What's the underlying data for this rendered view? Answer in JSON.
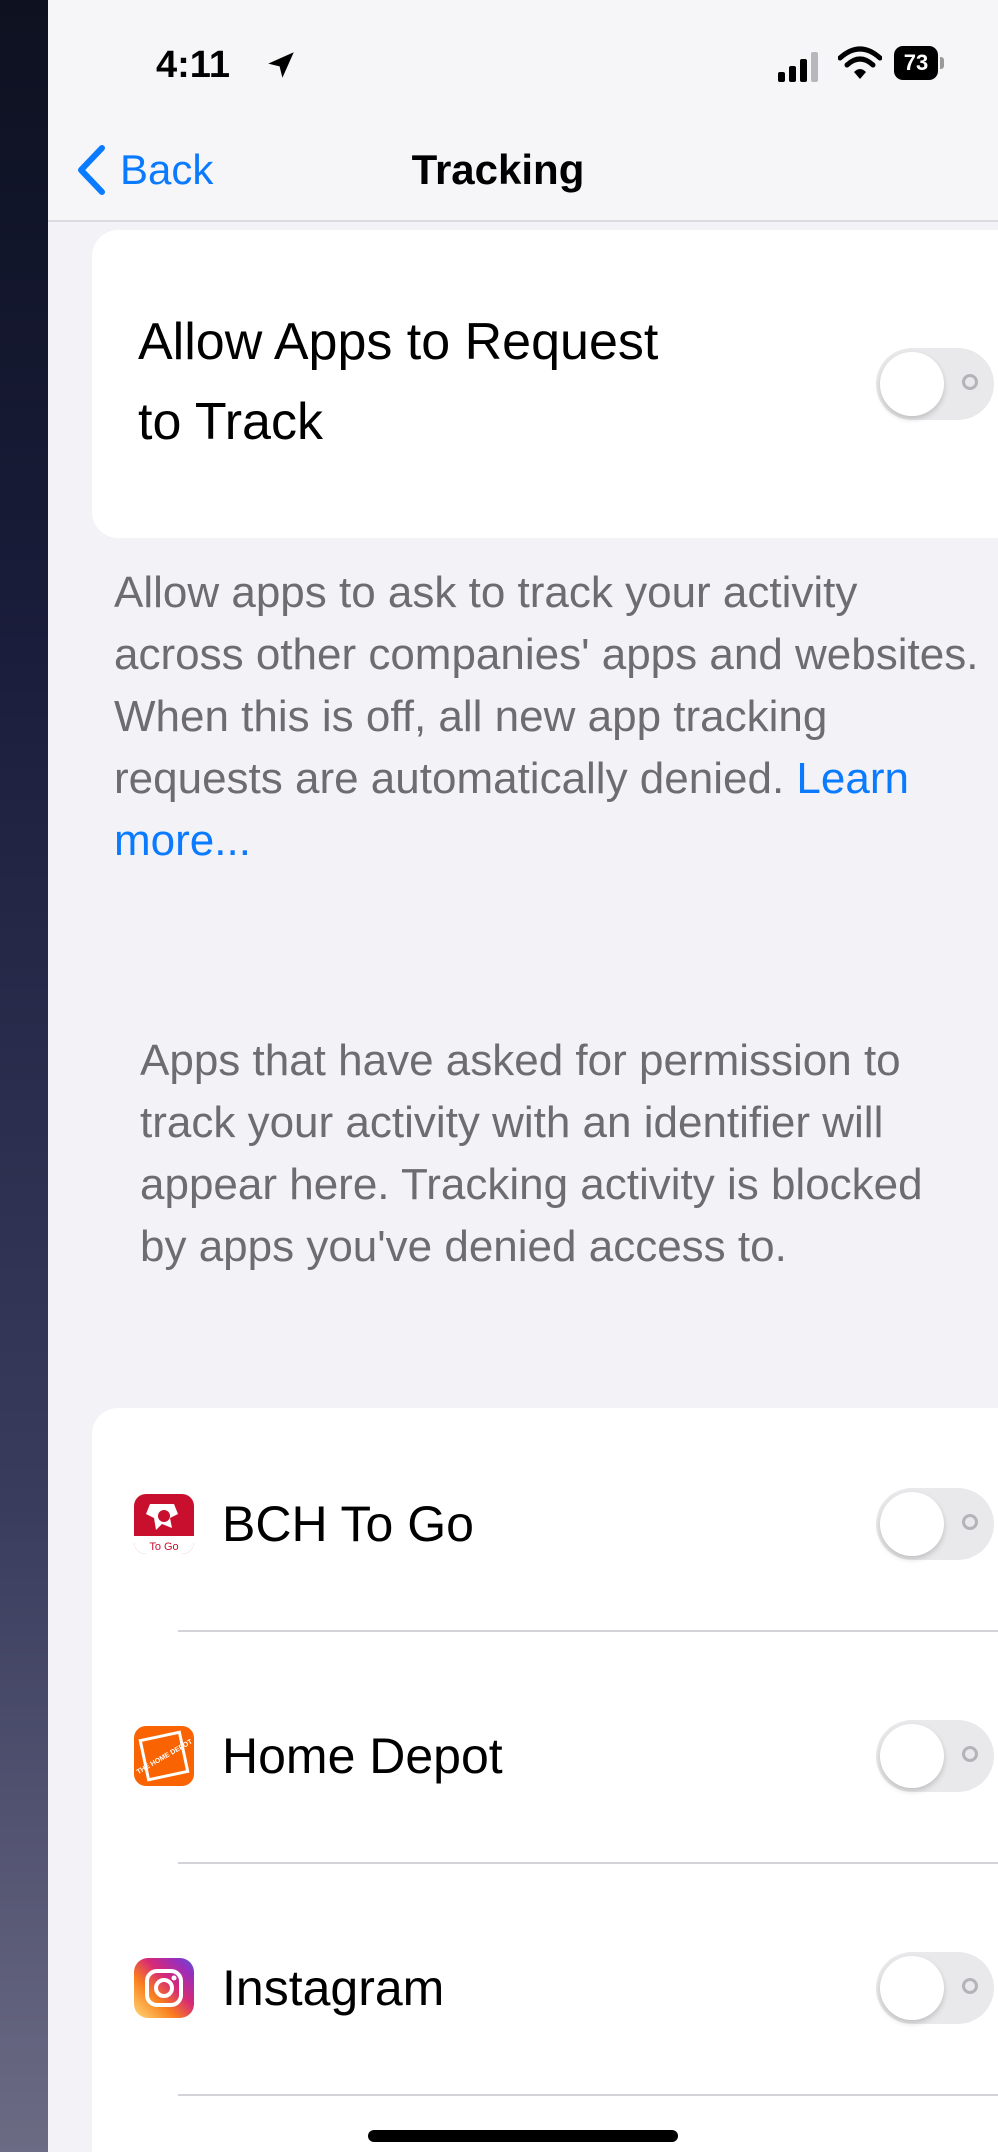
{
  "status_bar": {
    "time": "4:11",
    "battery_level": "73",
    "icons": [
      "location-arrow-icon",
      "cellular-signal-icon",
      "wifi-icon",
      "battery-icon"
    ]
  },
  "nav": {
    "back_label": "Back",
    "title": "Tracking"
  },
  "tracking_setting": {
    "label": "Allow Apps to Request to Track",
    "enabled": false
  },
  "description": {
    "text": "Allow apps to ask to track your activity across other companies' apps and websites. When this is off, all new app tracking requests are automatically denied.",
    "link": "Learn more..."
  },
  "apps_note": "Apps that have asked for permission to track your activity with an identifier will appear here. Tracking activity is blocked by apps you've denied access to.",
  "apps": [
    {
      "name": "BCH To Go",
      "icon": "bch-to-go-app-icon",
      "icon_text": "To Go",
      "enabled": false
    },
    {
      "name": "Home Depot",
      "icon": "home-depot-app-icon",
      "icon_text": "THE HOME DEPOT",
      "enabled": false
    },
    {
      "name": "Instagram",
      "icon": "instagram-app-icon",
      "enabled": false
    }
  ],
  "colors": {
    "accent": "#0a7aff",
    "background": "#f2f2f7",
    "toggle_off": "#e9e9eb",
    "secondary_text": "#6c6c72"
  }
}
